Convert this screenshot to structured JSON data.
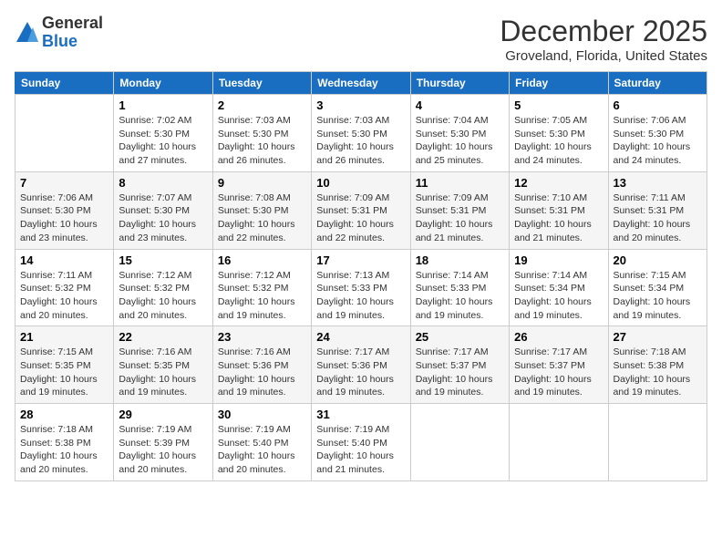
{
  "logo": {
    "general": "General",
    "blue": "Blue"
  },
  "title": "December 2025",
  "location": "Groveland, Florida, United States",
  "calendar": {
    "headers": [
      "Sunday",
      "Monday",
      "Tuesday",
      "Wednesday",
      "Thursday",
      "Friday",
      "Saturday"
    ],
    "weeks": [
      [
        {
          "day": "",
          "info": ""
        },
        {
          "day": "1",
          "info": "Sunrise: 7:02 AM\nSunset: 5:30 PM\nDaylight: 10 hours\nand 27 minutes."
        },
        {
          "day": "2",
          "info": "Sunrise: 7:03 AM\nSunset: 5:30 PM\nDaylight: 10 hours\nand 26 minutes."
        },
        {
          "day": "3",
          "info": "Sunrise: 7:03 AM\nSunset: 5:30 PM\nDaylight: 10 hours\nand 26 minutes."
        },
        {
          "day": "4",
          "info": "Sunrise: 7:04 AM\nSunset: 5:30 PM\nDaylight: 10 hours\nand 25 minutes."
        },
        {
          "day": "5",
          "info": "Sunrise: 7:05 AM\nSunset: 5:30 PM\nDaylight: 10 hours\nand 24 minutes."
        },
        {
          "day": "6",
          "info": "Sunrise: 7:06 AM\nSunset: 5:30 PM\nDaylight: 10 hours\nand 24 minutes."
        }
      ],
      [
        {
          "day": "7",
          "info": "Sunrise: 7:06 AM\nSunset: 5:30 PM\nDaylight: 10 hours\nand 23 minutes."
        },
        {
          "day": "8",
          "info": "Sunrise: 7:07 AM\nSunset: 5:30 PM\nDaylight: 10 hours\nand 23 minutes."
        },
        {
          "day": "9",
          "info": "Sunrise: 7:08 AM\nSunset: 5:30 PM\nDaylight: 10 hours\nand 22 minutes."
        },
        {
          "day": "10",
          "info": "Sunrise: 7:09 AM\nSunset: 5:31 PM\nDaylight: 10 hours\nand 22 minutes."
        },
        {
          "day": "11",
          "info": "Sunrise: 7:09 AM\nSunset: 5:31 PM\nDaylight: 10 hours\nand 21 minutes."
        },
        {
          "day": "12",
          "info": "Sunrise: 7:10 AM\nSunset: 5:31 PM\nDaylight: 10 hours\nand 21 minutes."
        },
        {
          "day": "13",
          "info": "Sunrise: 7:11 AM\nSunset: 5:31 PM\nDaylight: 10 hours\nand 20 minutes."
        }
      ],
      [
        {
          "day": "14",
          "info": "Sunrise: 7:11 AM\nSunset: 5:32 PM\nDaylight: 10 hours\nand 20 minutes."
        },
        {
          "day": "15",
          "info": "Sunrise: 7:12 AM\nSunset: 5:32 PM\nDaylight: 10 hours\nand 20 minutes."
        },
        {
          "day": "16",
          "info": "Sunrise: 7:12 AM\nSunset: 5:32 PM\nDaylight: 10 hours\nand 19 minutes."
        },
        {
          "day": "17",
          "info": "Sunrise: 7:13 AM\nSunset: 5:33 PM\nDaylight: 10 hours\nand 19 minutes."
        },
        {
          "day": "18",
          "info": "Sunrise: 7:14 AM\nSunset: 5:33 PM\nDaylight: 10 hours\nand 19 minutes."
        },
        {
          "day": "19",
          "info": "Sunrise: 7:14 AM\nSunset: 5:34 PM\nDaylight: 10 hours\nand 19 minutes."
        },
        {
          "day": "20",
          "info": "Sunrise: 7:15 AM\nSunset: 5:34 PM\nDaylight: 10 hours\nand 19 minutes."
        }
      ],
      [
        {
          "day": "21",
          "info": "Sunrise: 7:15 AM\nSunset: 5:35 PM\nDaylight: 10 hours\nand 19 minutes."
        },
        {
          "day": "22",
          "info": "Sunrise: 7:16 AM\nSunset: 5:35 PM\nDaylight: 10 hours\nand 19 minutes."
        },
        {
          "day": "23",
          "info": "Sunrise: 7:16 AM\nSunset: 5:36 PM\nDaylight: 10 hours\nand 19 minutes."
        },
        {
          "day": "24",
          "info": "Sunrise: 7:17 AM\nSunset: 5:36 PM\nDaylight: 10 hours\nand 19 minutes."
        },
        {
          "day": "25",
          "info": "Sunrise: 7:17 AM\nSunset: 5:37 PM\nDaylight: 10 hours\nand 19 minutes."
        },
        {
          "day": "26",
          "info": "Sunrise: 7:17 AM\nSunset: 5:37 PM\nDaylight: 10 hours\nand 19 minutes."
        },
        {
          "day": "27",
          "info": "Sunrise: 7:18 AM\nSunset: 5:38 PM\nDaylight: 10 hours\nand 19 minutes."
        }
      ],
      [
        {
          "day": "28",
          "info": "Sunrise: 7:18 AM\nSunset: 5:38 PM\nDaylight: 10 hours\nand 20 minutes."
        },
        {
          "day": "29",
          "info": "Sunrise: 7:19 AM\nSunset: 5:39 PM\nDaylight: 10 hours\nand 20 minutes."
        },
        {
          "day": "30",
          "info": "Sunrise: 7:19 AM\nSunset: 5:40 PM\nDaylight: 10 hours\nand 20 minutes."
        },
        {
          "day": "31",
          "info": "Sunrise: 7:19 AM\nSunset: 5:40 PM\nDaylight: 10 hours\nand 21 minutes."
        },
        {
          "day": "",
          "info": ""
        },
        {
          "day": "",
          "info": ""
        },
        {
          "day": "",
          "info": ""
        }
      ]
    ]
  }
}
